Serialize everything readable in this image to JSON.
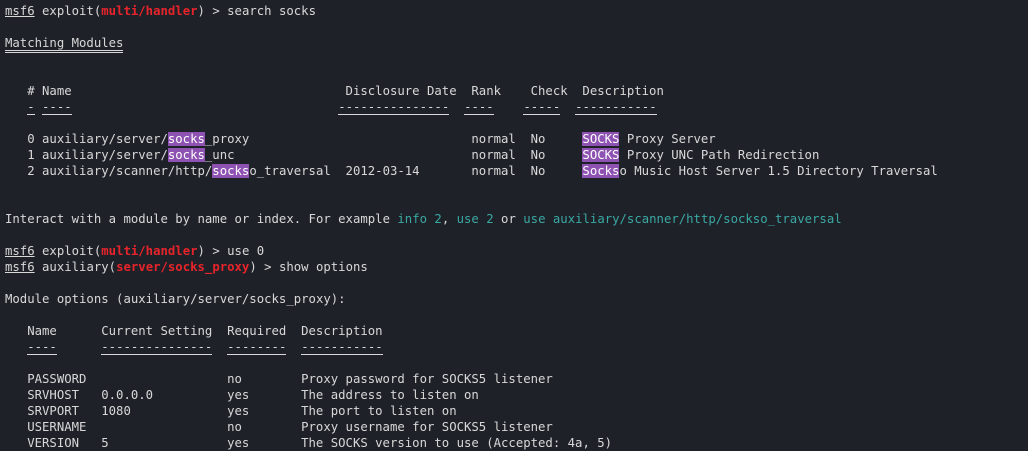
{
  "cmd1": {
    "prompt": "msf6",
    "word": "exploit",
    "module": "multi/handler",
    "rest": " > search socks"
  },
  "search": {
    "heading": "Matching Modules",
    "cols": [
      "#",
      "Name",
      "Disclosure Date",
      "Rank",
      "Check",
      "Description"
    ],
    "rows": [
      {
        "num": "0",
        "name_a": "auxiliary/server/",
        "name_b": "socks",
        "name_c": "_proxy",
        "date": "",
        "rank": "normal",
        "check": "No",
        "desc_a": "SOCKS",
        "desc_b": " Proxy Server"
      },
      {
        "num": "1",
        "name_a": "auxiliary/server/",
        "name_b": "socks",
        "name_c": "_unc",
        "date": "",
        "rank": "normal",
        "check": "No",
        "desc_a": "SOCKS",
        "desc_b": " Proxy UNC Path Redirection"
      },
      {
        "num": "2",
        "name_a": "auxiliary/scanner/http/",
        "name_b": "socks",
        "name_c": "o_traversal",
        "date": "2012-03-14",
        "rank": "normal",
        "check": "No",
        "desc_a": "Socks",
        "desc_b": "o Music Host Server 1.5 Directory Traversal"
      }
    ]
  },
  "hint": {
    "a": "Interact with a module by name or index. For example ",
    "l1": "info 2",
    "b": ", ",
    "l2": "use 2",
    "c": " or ",
    "l3": "use auxiliary/scanner/http/sockso_traversal"
  },
  "cmd2": {
    "prompt": "msf6",
    "word": "exploit",
    "module": "multi/handler",
    "rest": " > use 0"
  },
  "cmd3": {
    "prompt": "msf6",
    "word": "auxiliary",
    "module": "server/socks_proxy",
    "rest": " > show options"
  },
  "opts": {
    "heading": "Module options (auxiliary/server/socks_proxy):",
    "cols": [
      "Name",
      "Current Setting",
      "Required",
      "Description"
    ],
    "rows": [
      {
        "name": "PASSWORD",
        "setting": "",
        "req": "no",
        "desc": "Proxy password for SOCKS5 listener"
      },
      {
        "name": "SRVHOST",
        "setting": "0.0.0.0",
        "req": "yes",
        "desc": "The address to listen on"
      },
      {
        "name": "SRVPORT",
        "setting": "1080",
        "req": "yes",
        "desc": "The port to listen on"
      },
      {
        "name": "USERNAME",
        "setting": "",
        "req": "no",
        "desc": "Proxy username for SOCKS5 listener"
      },
      {
        "name": "VERSION",
        "setting": "5",
        "req": "yes",
        "desc": "The SOCKS version to use (Accepted: 4a, 5)"
      }
    ]
  }
}
